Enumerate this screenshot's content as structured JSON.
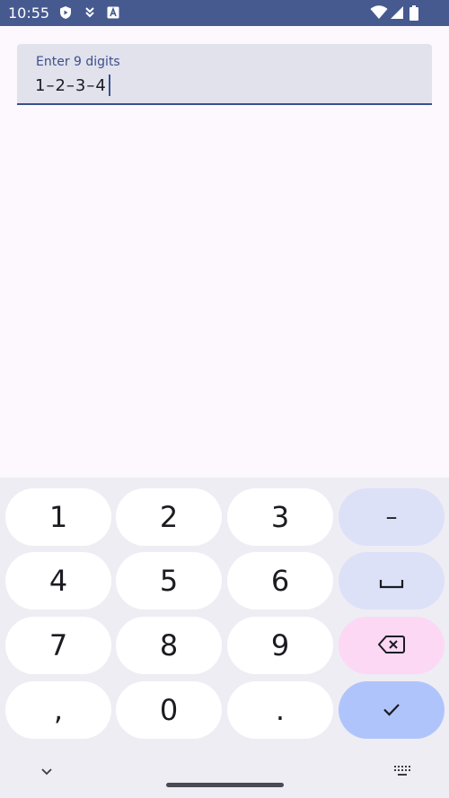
{
  "status_bar": {
    "time": "10:55",
    "icons_left": [
      "shield-play-icon",
      "download-arrows-icon",
      "a-box-icon"
    ],
    "icons_right": [
      "wifi-icon",
      "signal-icon",
      "battery-icon"
    ]
  },
  "textfield": {
    "label": "Enter 9 digits",
    "value": "1–2–3–4"
  },
  "keyboard": {
    "row1": [
      "1",
      "2",
      "3",
      "–"
    ],
    "row2": [
      "4",
      "5",
      "6",
      "␣"
    ],
    "row3": [
      "7",
      "8",
      "9",
      "backspace"
    ],
    "row4": [
      ",",
      "0",
      ".",
      "enter"
    ]
  },
  "nav": {
    "left_icon": "chevron-down-icon",
    "right_icon": "keyboard-icon"
  },
  "colors": {
    "status_bar": "#465a90",
    "accent": "#3c4f8c",
    "field_bg": "#e1e2ec",
    "key_func": "#dde1f8",
    "key_delete": "#fcd8f4",
    "key_enter": "#b0c4fc"
  }
}
